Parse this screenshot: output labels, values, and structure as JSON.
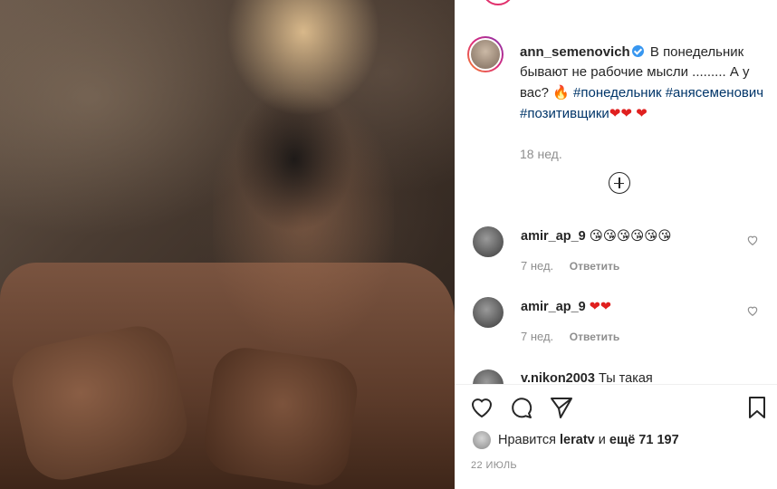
{
  "post": {
    "caption": {
      "username": "ann_semenovich",
      "text_parts": [
        "В понедельник бывают не рабочие мысли ......... А у вас?",
        "🔥",
        "#понедельник",
        "#анясеменович",
        "#позитивщики",
        "❤❤",
        "❤"
      ],
      "time": "18 нед."
    },
    "comments": [
      {
        "username": "amir_ap_9",
        "text": "😘😘😘😘😘😘",
        "time": "7 нед.",
        "reply_label": "Ответить"
      },
      {
        "username": "amir_ap_9",
        "text": "❤❤",
        "time": "7 нед.",
        "reply_label": "Ответить"
      },
      {
        "username": "v.nikon2003",
        "text": "Ты такая"
      }
    ],
    "likes": {
      "prefix": "Нравится",
      "user": "leratv",
      "joiner": "и",
      "others": "ещё 71 197"
    },
    "date": "22 ИЮЛЬ"
  },
  "colors": {
    "link": "#003569",
    "verified": "#3897f0",
    "muted": "#8e8e8e",
    "heart": "#e0201f"
  },
  "icons": [
    "verified-badge-icon",
    "add-comments-icon",
    "comment-like-icon",
    "like-icon",
    "comment-icon",
    "share-icon",
    "save-icon"
  ]
}
